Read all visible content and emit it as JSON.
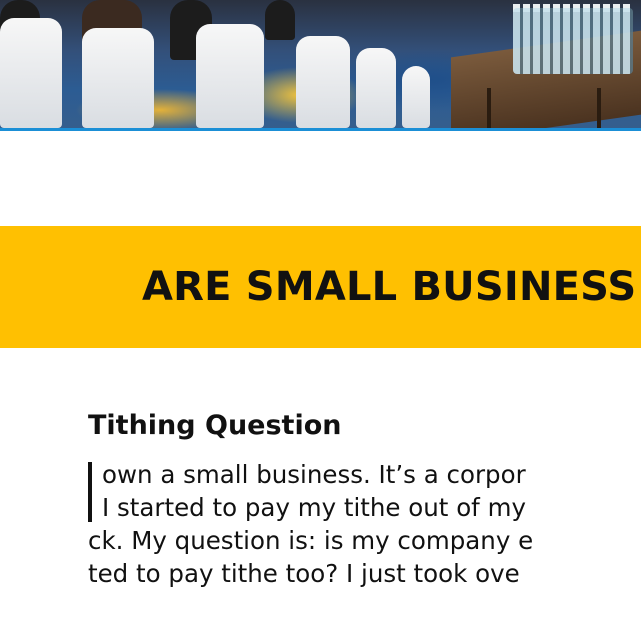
{
  "banner": {
    "title": "ARE SMALL BUSINESS"
  },
  "article": {
    "section_heading": "Tithing Question",
    "lines": [
      "own a small business. It’s a corpor",
      "I started to pay my tithe out of my",
      "ck. My question is: is my company e",
      "ted to pay tithe too? I just took ove"
    ]
  },
  "colors": {
    "banner_background": "#ffc001",
    "hero_border": "#1b8fd6",
    "text": "#111111"
  },
  "icons": {
    "drop_cap": "letter-I-drop-cap"
  }
}
